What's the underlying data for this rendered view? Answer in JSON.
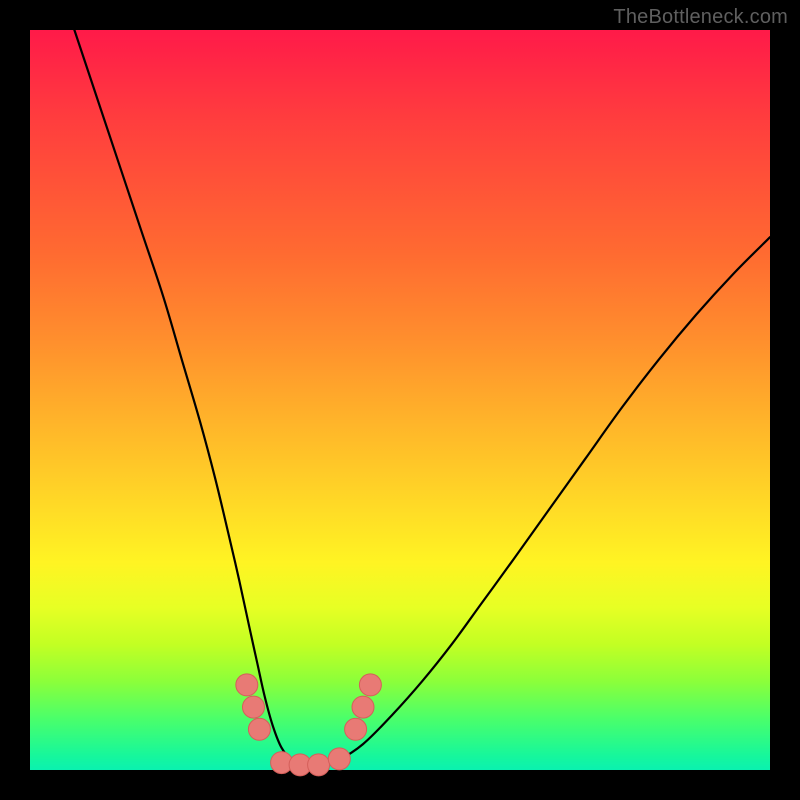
{
  "watermark": "TheBottleneck.com",
  "colors": {
    "frame": "#000000",
    "curve": "#000000",
    "marker_fill": "#e87a75",
    "marker_stroke": "#d45f5a",
    "gradient_stops": [
      {
        "pos": 0.0,
        "color": "#ff1a49"
      },
      {
        "pos": 0.12,
        "color": "#ff3d3e"
      },
      {
        "pos": 0.3,
        "color": "#ff6a31"
      },
      {
        "pos": 0.42,
        "color": "#ff8f2d"
      },
      {
        "pos": 0.52,
        "color": "#ffb12a"
      },
      {
        "pos": 0.62,
        "color": "#ffd227"
      },
      {
        "pos": 0.72,
        "color": "#fff423"
      },
      {
        "pos": 0.78,
        "color": "#e7ff24"
      },
      {
        "pos": 0.83,
        "color": "#c3ff23"
      },
      {
        "pos": 0.88,
        "color": "#8cff3a"
      },
      {
        "pos": 0.93,
        "color": "#4bff6a"
      },
      {
        "pos": 0.98,
        "color": "#17f79b"
      },
      {
        "pos": 1.0,
        "color": "#0af1b0"
      }
    ]
  },
  "chart_data": {
    "type": "line",
    "title": "",
    "xlabel": "",
    "ylabel": "",
    "xlim": [
      0,
      1
    ],
    "ylim": [
      0,
      1
    ],
    "grid": false,
    "legend": false,
    "description": "Bottleneck V-curve; y ~ 0 at the minimum, rising steeply to both sides. Left arm rises faster than right arm.",
    "series": [
      {
        "name": "bottleneck-curve",
        "x": [
          0.06,
          0.09,
          0.12,
          0.15,
          0.18,
          0.205,
          0.23,
          0.25,
          0.268,
          0.283,
          0.296,
          0.307,
          0.317,
          0.328,
          0.34,
          0.355,
          0.372,
          0.392,
          0.415,
          0.45,
          0.49,
          0.53,
          0.57,
          0.61,
          0.65,
          0.7,
          0.75,
          0.8,
          0.85,
          0.9,
          0.95,
          1.0
        ],
        "y": [
          1.0,
          0.91,
          0.82,
          0.73,
          0.64,
          0.555,
          0.47,
          0.395,
          0.32,
          0.255,
          0.195,
          0.145,
          0.1,
          0.06,
          0.03,
          0.012,
          0.004,
          0.004,
          0.012,
          0.035,
          0.075,
          0.12,
          0.17,
          0.225,
          0.28,
          0.35,
          0.42,
          0.49,
          0.555,
          0.615,
          0.67,
          0.72
        ]
      }
    ],
    "markers": [
      {
        "x": 0.293,
        "y": 0.115,
        "r": 11
      },
      {
        "x": 0.302,
        "y": 0.085,
        "r": 11
      },
      {
        "x": 0.31,
        "y": 0.055,
        "r": 11
      },
      {
        "x": 0.34,
        "y": 0.01,
        "r": 11
      },
      {
        "x": 0.365,
        "y": 0.007,
        "r": 11
      },
      {
        "x": 0.39,
        "y": 0.007,
        "r": 11
      },
      {
        "x": 0.418,
        "y": 0.015,
        "r": 11
      },
      {
        "x": 0.44,
        "y": 0.055,
        "r": 11
      },
      {
        "x": 0.45,
        "y": 0.085,
        "r": 11
      },
      {
        "x": 0.46,
        "y": 0.115,
        "r": 11
      }
    ],
    "minimum": {
      "x": 0.382,
      "y": 0.004
    }
  }
}
